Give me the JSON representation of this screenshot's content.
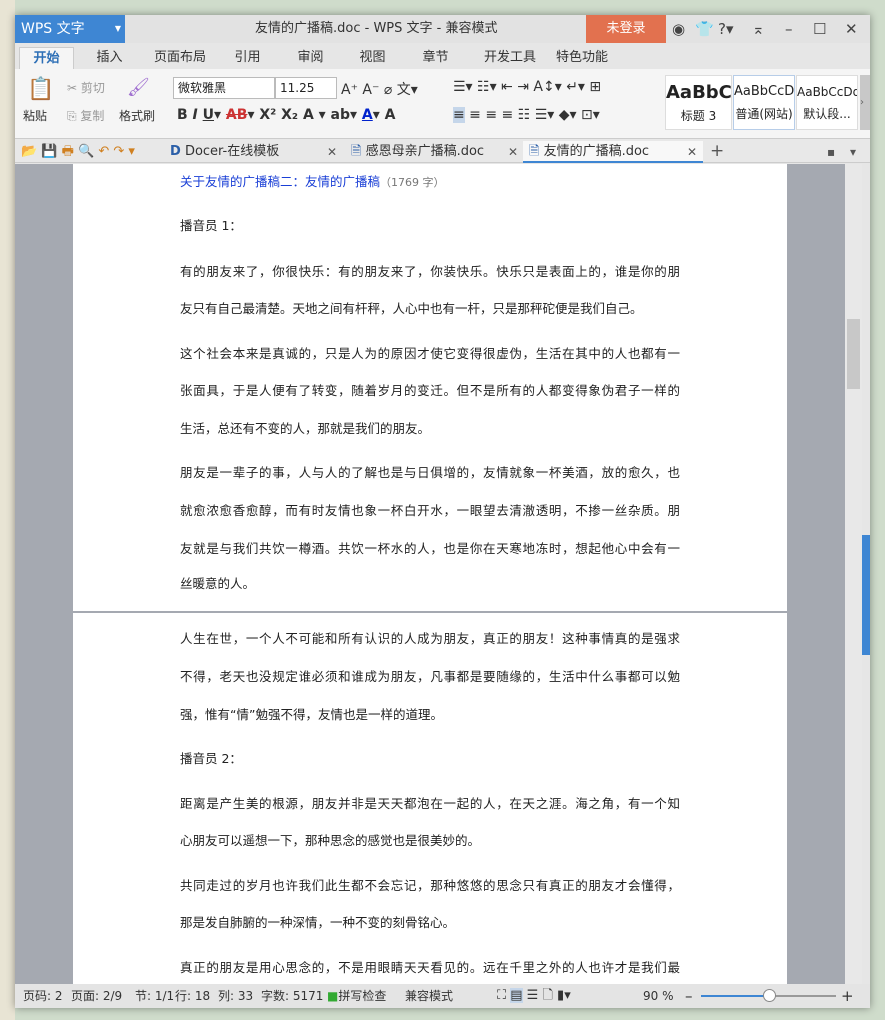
{
  "window": {
    "app_name": "WPS 文字",
    "title": "友情的广播稿.doc - WPS 文字 - 兼容模式",
    "login": "未登录"
  },
  "ribbon_tabs": [
    "开始",
    "插入",
    "页面布局",
    "引用",
    "审阅",
    "视图",
    "章节",
    "开发工具",
    "特色功能"
  ],
  "ribbon": {
    "paste": "粘贴",
    "cut": "剪切",
    "copy": "复制",
    "format_painter": "格式刷",
    "font": "微软雅黑",
    "size": "11.25",
    "styles": [
      {
        "preview": "AaBbC",
        "label": "标题 3"
      },
      {
        "preview": "AaBbCcD",
        "label": "普通(网站)"
      },
      {
        "preview": "AaBbCcDd",
        "label": "默认段..."
      }
    ]
  },
  "doc_tabs": [
    {
      "label": "Docer-在线模板"
    },
    {
      "label": "感恩母亲广播稿.doc"
    },
    {
      "label": "友情的广播稿.doc"
    }
  ],
  "document": {
    "title_link": "关于友情的广播稿二：友情的广播稿",
    "title_count": "（1769 字）",
    "page1": [
      {
        "text": "播音员 1：",
        "last": true
      },
      {
        "text": "有的朋友来了，你很快乐：有的朋友来了，你装快乐。快乐只是表面上的，谁是你的朋"
      },
      {
        "text": "友只有自己最清楚。天地之间有杆秤，人心中也有一杆，只是那秤砣便是我们自己。",
        "last": true
      },
      {
        "text": "这个社会本来是真诚的，只是人为的原因才使它变得很虚伪，生活在其中的人也都有一"
      },
      {
        "text": "张面具，于是人便有了转变，随着岁月的变迁。但不是所有的人都变得象伪君子一样的"
      },
      {
        "text": "生活，总还有不变的人，那就是我们的朋友。",
        "last": true
      },
      {
        "text": "朋友是一辈子的事，人与人的了解也是与日俱增的，友情就象一杯美酒，放的愈久，也"
      },
      {
        "text": "就愈浓愈香愈醇，而有时友情也象一杯白开水，一眼望去清澈透明，不掺一丝杂质。朋"
      },
      {
        "text": "友就是与我们共饮一樽酒。共饮一杯水的人，也是你在天寒地冻时，想起他心中会有一"
      },
      {
        "text": "丝暖意的人。",
        "last": true
      }
    ],
    "page2": [
      {
        "text": "人生在世，一个人不可能和所有认识的人成为朋友，真正的朋友！这种事情真的是强求"
      },
      {
        "text": "不得，老天也没规定谁必须和谁成为朋友，凡事都是要随缘的，生活中什么事都可以勉"
      },
      {
        "text": "强，惟有“情”勉强不得，友情也是一样的道理。",
        "last": true
      },
      {
        "text": "播音员 2：",
        "last": true
      },
      {
        "text": "距离是产生美的根源，朋友并非是天天都泡在一起的人，在天之涯。海之角，有一个知"
      },
      {
        "text": "心朋友可以遥想一下，那种思念的感觉也是很美妙的。",
        "last": true
      },
      {
        "text": "共同走过的岁月也许我们此生都不会忘记，那种悠悠的思念只有真正的朋友才会懂得，"
      },
      {
        "text": "那是发自肺腑的一种深情，一种不变的刻骨铭心。",
        "last": true
      },
      {
        "text": "真正的朋友是用心思念的，不是用眼睛天天看见的。远在千里之外的人也许才是我们最"
      }
    ]
  },
  "status": {
    "page_no": "页码: 2",
    "pages": "页面: 2/9",
    "section": "节: 1/1",
    "line": "行: 18",
    "col": "列: 33",
    "words": "字数: 5171",
    "spell": "拼写检查",
    "compat": "兼容模式",
    "zoom": "90 %",
    "zoom_fraction": 0.5
  },
  "colors": {
    "accent": "#3e86d3",
    "login": "#e2714f",
    "link": "#1a3fd6"
  }
}
